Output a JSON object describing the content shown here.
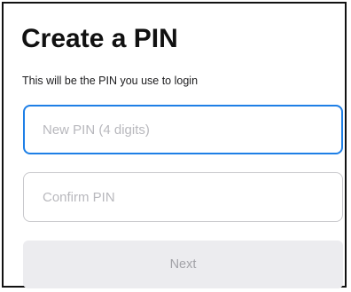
{
  "header": {
    "title": "Create a PIN",
    "subtitle": "This will be the PIN you use to login"
  },
  "form": {
    "new_pin": {
      "value": "",
      "placeholder": "New PIN (4 digits)",
      "focused": true
    },
    "confirm_pin": {
      "value": "",
      "placeholder": "Confirm PIN",
      "focused": false
    },
    "next_label": "Next",
    "next_enabled": false
  },
  "colors": {
    "focus_border": "#1e7fe6",
    "field_border": "#c8c8cc",
    "placeholder_text": "#b8b8bd",
    "disabled_button_bg": "#ececef",
    "disabled_button_text": "#a3a3a8"
  }
}
